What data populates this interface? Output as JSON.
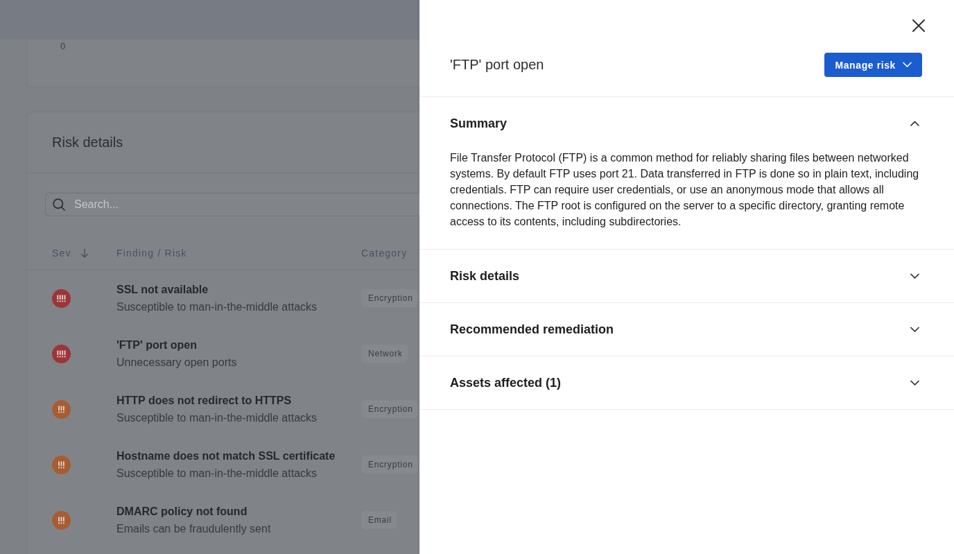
{
  "overview_card": {
    "axis_label": "0"
  },
  "risk_details": {
    "title": "Risk details",
    "search": {
      "placeholder": "Search..."
    },
    "columns": [
      {
        "label": "Sev.",
        "sorted": true
      },
      {
        "label": "Finding / Risk",
        "sorted": false
      },
      {
        "label": "Category",
        "sorted": false
      }
    ],
    "rows": [
      {
        "kind": "critical",
        "color": "#9c3538",
        "title": "SSL not available",
        "subtitle": "Susceptible to man-in-the-middle attacks",
        "category": "Encryption"
      },
      {
        "kind": "critical",
        "color": "#9c3538",
        "title": "'FTP' port open",
        "subtitle": "Unnecessary open ports",
        "category": "Network"
      },
      {
        "kind": "high",
        "color": "#a85c32",
        "title": "HTTP does not redirect to HTTPS",
        "subtitle": "Susceptible to man-in-the-middle attacks",
        "category": "Encryption"
      },
      {
        "kind": "high",
        "color": "#a85c32",
        "title": "Hostname does not match SSL certificate",
        "subtitle": "Susceptible to man-in-the-middle attacks",
        "category": "Encryption"
      },
      {
        "kind": "high",
        "color": "#a85c32",
        "title": "DMARC policy not found",
        "subtitle": "Emails can be fraudulently sent",
        "category": "Email"
      }
    ]
  },
  "drawer": {
    "title": "'FTP' port open",
    "action_button": {
      "label": "Manage risk"
    },
    "sections": [
      {
        "title": "Summary",
        "expanded": true,
        "body": "File Transfer Protocol (FTP) is a common method for reliably sharing files between networked systems. By default FTP uses port 21. Data transferred in FTP is done so in plain text, including credentials. FTP can require user credentials, or use an anonymous mode that allows all connections. The FTP root is configured on the server to a specific directory, granting remote access to its contents, including subdirectories."
      },
      {
        "title": "Risk details",
        "expanded": false
      },
      {
        "title": "Recommended remediation",
        "expanded": false
      },
      {
        "title": "Assets affected (1)",
        "expanded": false
      }
    ]
  }
}
